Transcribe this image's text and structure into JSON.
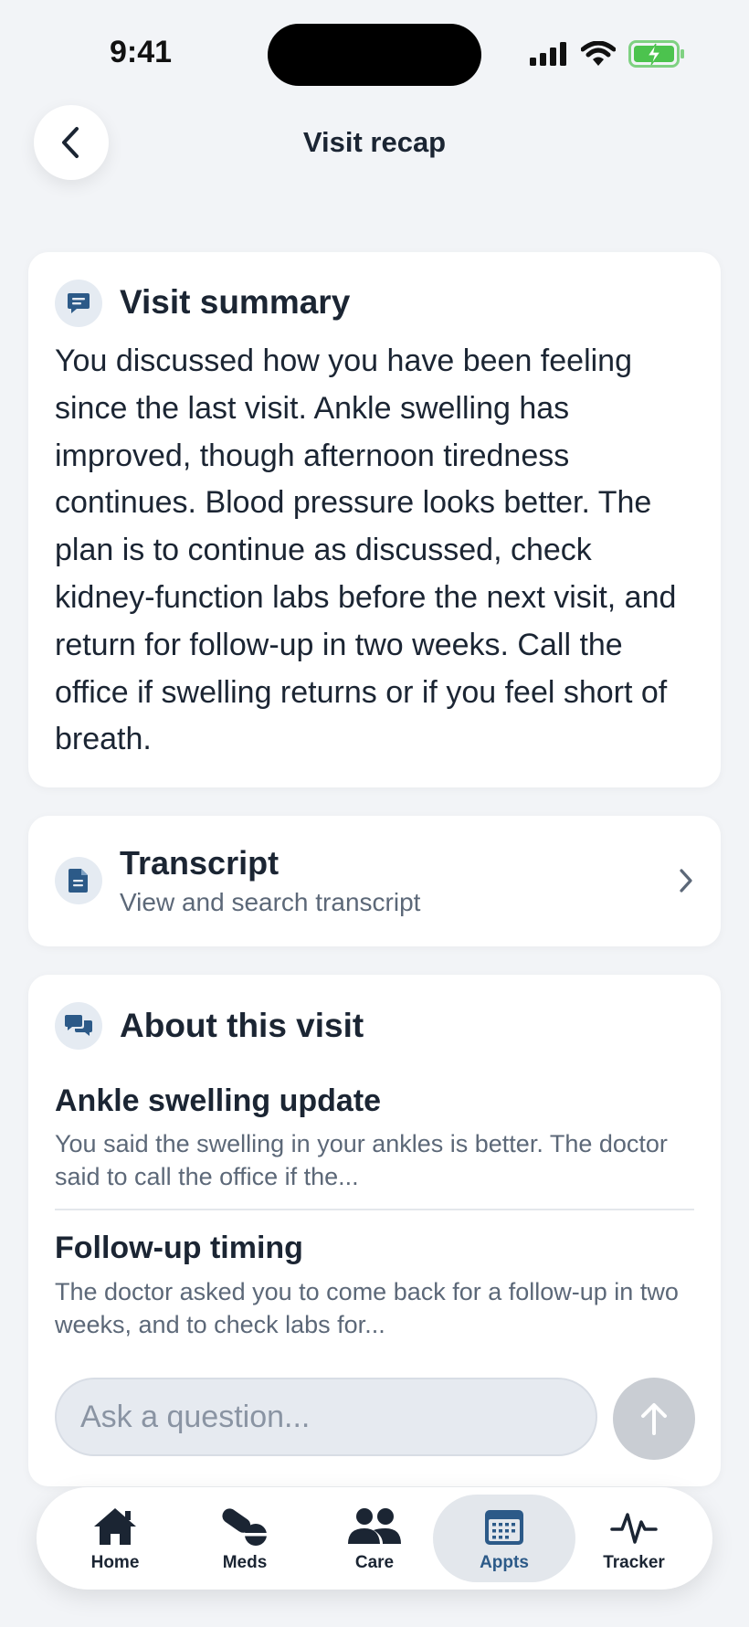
{
  "status_bar": {
    "time": "9:41"
  },
  "header": {
    "title": "Visit recap",
    "back_icon": "chevron-left-icon"
  },
  "summary": {
    "heading": "Visit summary",
    "icon": "message-icon",
    "body": "You discussed how you have been feeling since the last visit. Ankle swelling has improved, though afternoon tiredness continues. Blood pressure looks better. The plan is to continue as discussed, check kidney-function labs before the next visit, and return for follow-up in two weeks. Call the office if swelling returns or if you feel short of breath."
  },
  "transcript": {
    "heading": "Transcript",
    "subtitle": "View and search transcript",
    "icon": "document-icon"
  },
  "about": {
    "heading": "About this visit",
    "icon": "chat-bubbles-icon",
    "topics": [
      {
        "title": "Ankle swelling update",
        "description": "You said the swelling in your ankles is better. The doctor said to call the office if the..."
      },
      {
        "title": "Follow-up timing",
        "description": "The doctor asked you to come back for a follow-up in two weeks, and to check labs for..."
      }
    ]
  },
  "ask": {
    "placeholder": "Ask a question..."
  },
  "tabbar": {
    "tabs": [
      {
        "label": "Home",
        "icon": "home-icon"
      },
      {
        "label": "Meds",
        "icon": "pills-icon"
      },
      {
        "label": "Care",
        "icon": "people-icon"
      },
      {
        "label": "Appts",
        "icon": "calendar-icon",
        "active": true
      },
      {
        "label": "Tracker",
        "icon": "pulse-icon"
      }
    ]
  },
  "colors": {
    "accent": "#2c5a88",
    "background": "#f2f4f7",
    "battery": "#4cc34e"
  }
}
